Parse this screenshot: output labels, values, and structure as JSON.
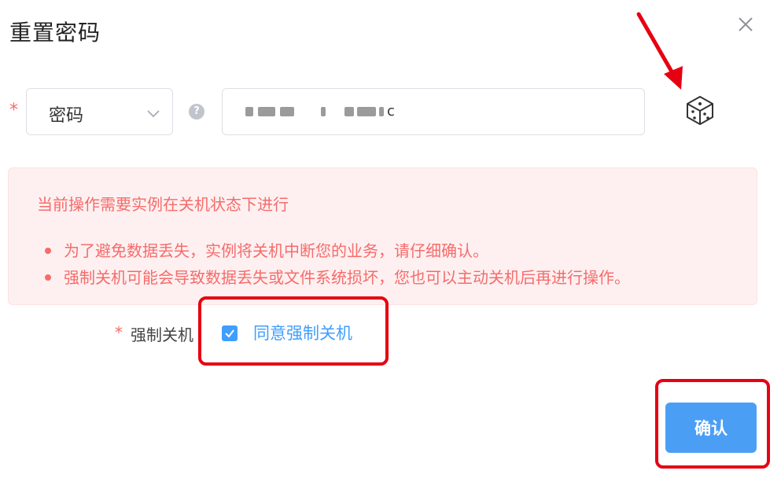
{
  "dialog": {
    "title": "重置密码",
    "close_icon": "close-icon"
  },
  "form": {
    "required_mark": "*",
    "credential_type": {
      "selected": "密码",
      "icon": "chevron-down-icon"
    },
    "help_icon": "question-icon",
    "help_glyph": "?",
    "password_value_visible_suffix": "c",
    "password_masked": true,
    "generate_icon": "dice-icon"
  },
  "alert": {
    "title": "当前操作需要实例在关机状态下进行",
    "items": [
      "为了避免数据丢失，实例将关机中断您的业务，请仔细确认。",
      "强制关机可能会导致数据丢失或文件系统损坏，您也可以主动关机后再进行操作。"
    ]
  },
  "force_shutdown": {
    "required_mark": "*",
    "label": "强制关机",
    "checkbox_label": "同意强制关机",
    "checked": true
  },
  "footer": {
    "confirm_label": "确认"
  },
  "colors": {
    "primary": "#409eff",
    "danger": "#f56c6c",
    "alert_bg": "#fef0f0",
    "annotation": "#e60012"
  }
}
